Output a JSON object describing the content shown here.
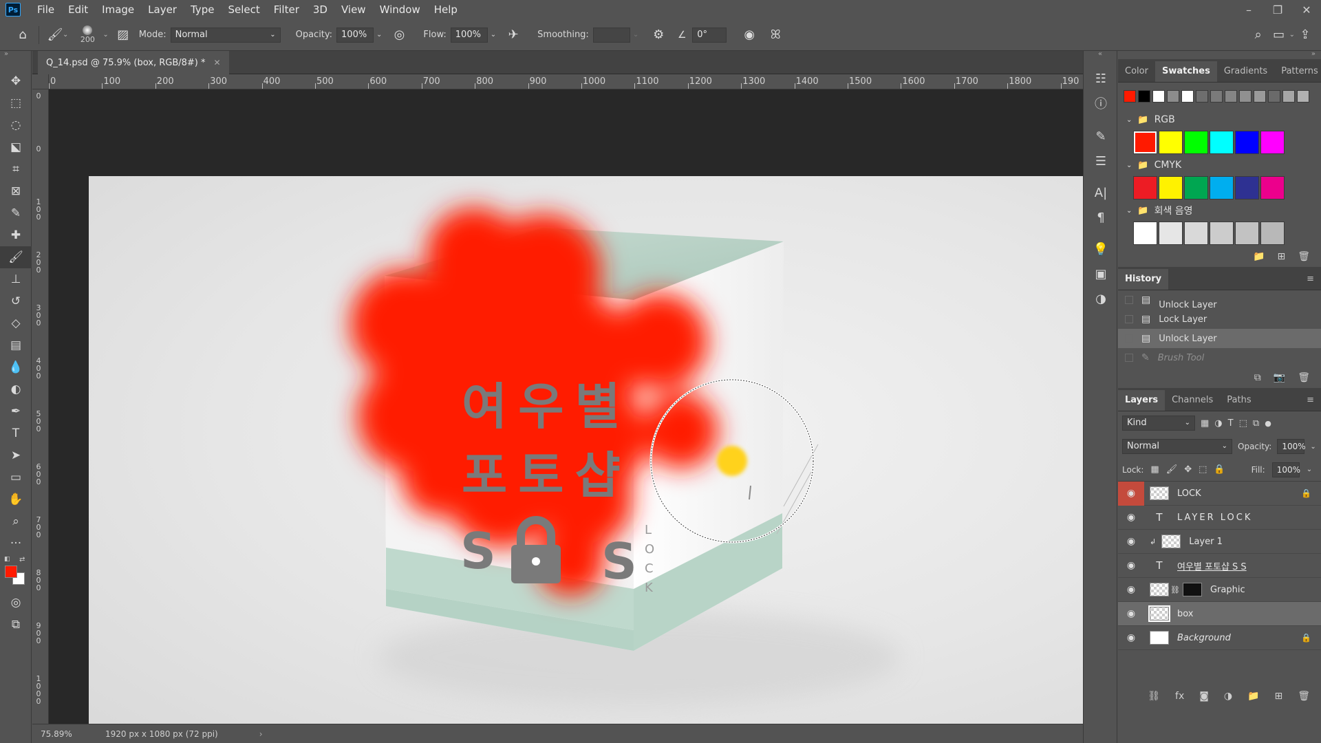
{
  "app": {
    "logo": "Ps"
  },
  "menu": [
    "File",
    "Edit",
    "Image",
    "Layer",
    "Type",
    "Select",
    "Filter",
    "3D",
    "View",
    "Window",
    "Help"
  ],
  "window_controls": {
    "minimize": "–",
    "restore": "❐",
    "close": "✕"
  },
  "options": {
    "brush_size": "200",
    "mode_label": "Mode:",
    "mode_value": "Normal",
    "opacity_label": "Opacity:",
    "opacity_value": "100%",
    "flow_label": "Flow:",
    "flow_value": "100%",
    "smoothing_label": "Smoothing:",
    "smoothing_value": "",
    "angle_value": "0°"
  },
  "document": {
    "tab_title": "Q_14.psd @ 75.9% (box, RGB/8#) *",
    "zoom": "75.89%",
    "doc_info": "1920 px x 1080 px (72 ppi)",
    "ruler_top": [
      "0",
      "100",
      "200",
      "300",
      "400",
      "500",
      "600",
      "700",
      "800",
      "900",
      "1000",
      "1100",
      "1200",
      "1300",
      "1400",
      "1500",
      "1600",
      "1700",
      "1800",
      "190"
    ],
    "ruler_left": [
      "0",
      "0",
      "100",
      "200",
      "300",
      "400",
      "500",
      "600",
      "700",
      "800",
      "900",
      "1000",
      "1"
    ]
  },
  "artwork": {
    "line1": "여우별",
    "line2": "포토샵",
    "s_left": "S",
    "s_right": "S",
    "vertical_lock": [
      "L",
      "O",
      "C",
      "K"
    ]
  },
  "swatches_panel": {
    "tabs": [
      "Color",
      "Swatches",
      "Gradients",
      "Patterns"
    ],
    "active_tab": "Swatches",
    "recent": [
      "#ff1a00",
      "#000000",
      "#ffffff",
      "#8c8c8c",
      "#ffffff",
      "#6e6e6e",
      "#7a7a7a",
      "#858585",
      "#909090",
      "#9b9b9b",
      "#6a6a6a",
      "#a6a6a6",
      "#b1b1b1"
    ],
    "groups": [
      {
        "name": "RGB",
        "colors": [
          "#ff1a00",
          "#ffff00",
          "#00ff00",
          "#00ffff",
          "#0000ff",
          "#ff00ff"
        ]
      },
      {
        "name": "CMYK",
        "colors": [
          "#ed1c24",
          "#fff200",
          "#00a651",
          "#00aeef",
          "#2e3192",
          "#ec008c"
        ]
      },
      {
        "name": "회색 음영",
        "colors": [
          "#ffffff",
          "#e6e6e6",
          "#d9d9d9",
          "#cccccc",
          "#c2c2c2",
          "#b8b8b8"
        ]
      }
    ]
  },
  "history": {
    "title": "History",
    "items": [
      {
        "label": "Unlock Layer",
        "state": "partial"
      },
      {
        "label": "Lock Layer",
        "state": "normal"
      },
      {
        "label": "Unlock Layer",
        "state": "selected"
      },
      {
        "label": "Brush Tool",
        "state": "disabled"
      }
    ]
  },
  "layers": {
    "tabs": [
      "Layers",
      "Channels",
      "Paths"
    ],
    "kind_label": "Kind",
    "blend_mode": "Normal",
    "opacity_label": "Opacity:",
    "opacity_value": "100%",
    "lock_label": "Lock:",
    "fill_label": "Fill:",
    "fill_value": "100%",
    "items": [
      {
        "name": "LOCK",
        "type": "pixel",
        "locked": true,
        "selected": false
      },
      {
        "name": "LAYER LOCK",
        "type": "text",
        "locked": false,
        "selected": false
      },
      {
        "name": "Layer 1",
        "type": "clipped",
        "locked": false,
        "selected": false
      },
      {
        "name": "여우별 포토샵 S  S",
        "type": "text",
        "locked": false,
        "selected": false
      },
      {
        "name": "Graphic",
        "type": "smart-mask",
        "locked": false,
        "selected": false
      },
      {
        "name": "box",
        "type": "pixel",
        "locked": false,
        "selected": true
      },
      {
        "name": "Background",
        "type": "background",
        "locked": true,
        "selected": false
      }
    ]
  },
  "colors": {
    "foreground": "#ff1a00",
    "background": "#ffffff",
    "accent_red": "#c44a3c"
  }
}
